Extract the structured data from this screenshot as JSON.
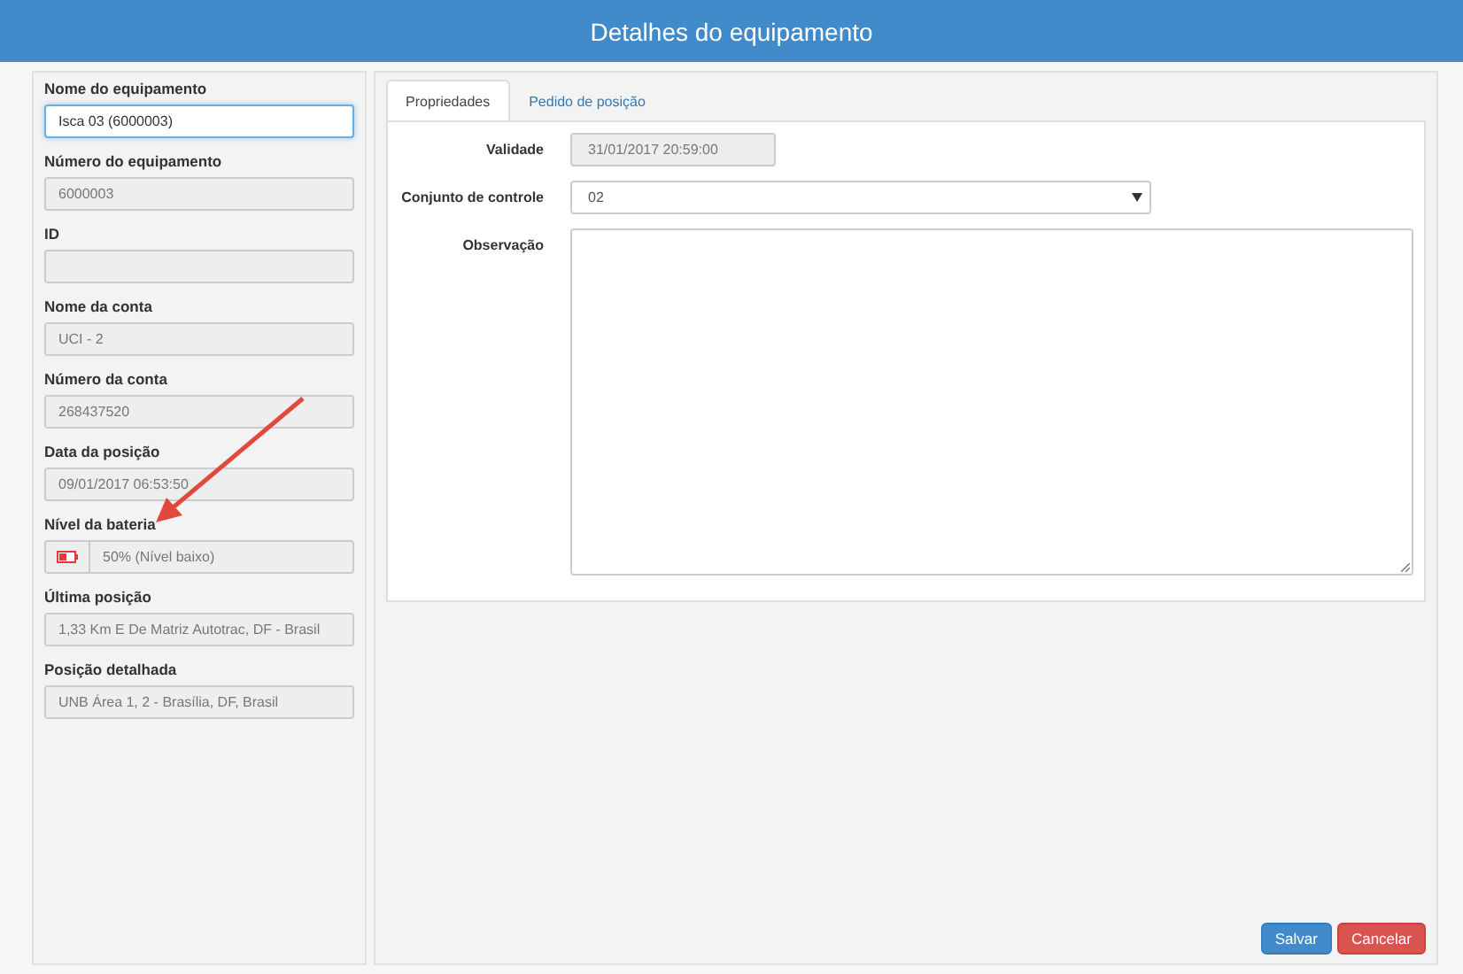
{
  "header": {
    "title": "Detalhes do equipamento"
  },
  "fields": [
    {
      "kind": "input",
      "label": "Nome do equipamento",
      "value": "Isca 03 (6000003)",
      "focused": true
    },
    {
      "kind": "input",
      "label": "Número do equipamento",
      "value": "6000003",
      "focused": false
    },
    {
      "kind": "input",
      "label": "ID",
      "focused": false
    },
    {
      "kind": "input",
      "label": "Nome da conta",
      "value": "UCI - 2",
      "focused": false
    },
    {
      "kind": "input",
      "label": "Número da conta",
      "value": "268437520",
      "focused": false
    },
    {
      "kind": "input",
      "label": "Data da posição",
      "value": "09/01/2017 06:53:50",
      "focused": false
    },
    {
      "kind": "battery",
      "label": "Nível da bateria",
      "value": "50% (Nível baixo)",
      "level": 0.5,
      "focused": false
    },
    {
      "kind": "input",
      "label": "Última posição",
      "value": "1,33 Km E De Matriz Autotrac, DF - Brasil",
      "focused": false
    },
    {
      "kind": "input",
      "label": "Posição detalhada",
      "value": "UNB Área 1, 2 - Brasília, DF, Brasil",
      "focused": false
    }
  ],
  "tabs": [
    {
      "label": "Propriedades",
      "selected": true
    },
    {
      "label": "Pedido de posição",
      "selected": false
    }
  ],
  "properties": [
    {
      "kind": "readonly",
      "label": "Validade",
      "value": "31/01/2017 20:59:00"
    },
    {
      "kind": "select",
      "label": "Conjunto de controle",
      "value": "02"
    },
    {
      "kind": "textarea",
      "label": "Observação"
    }
  ],
  "buttons": [
    {
      "kind": "primary",
      "label": "Salvar"
    },
    {
      "kind": "danger",
      "label": "Cancelar"
    }
  ]
}
